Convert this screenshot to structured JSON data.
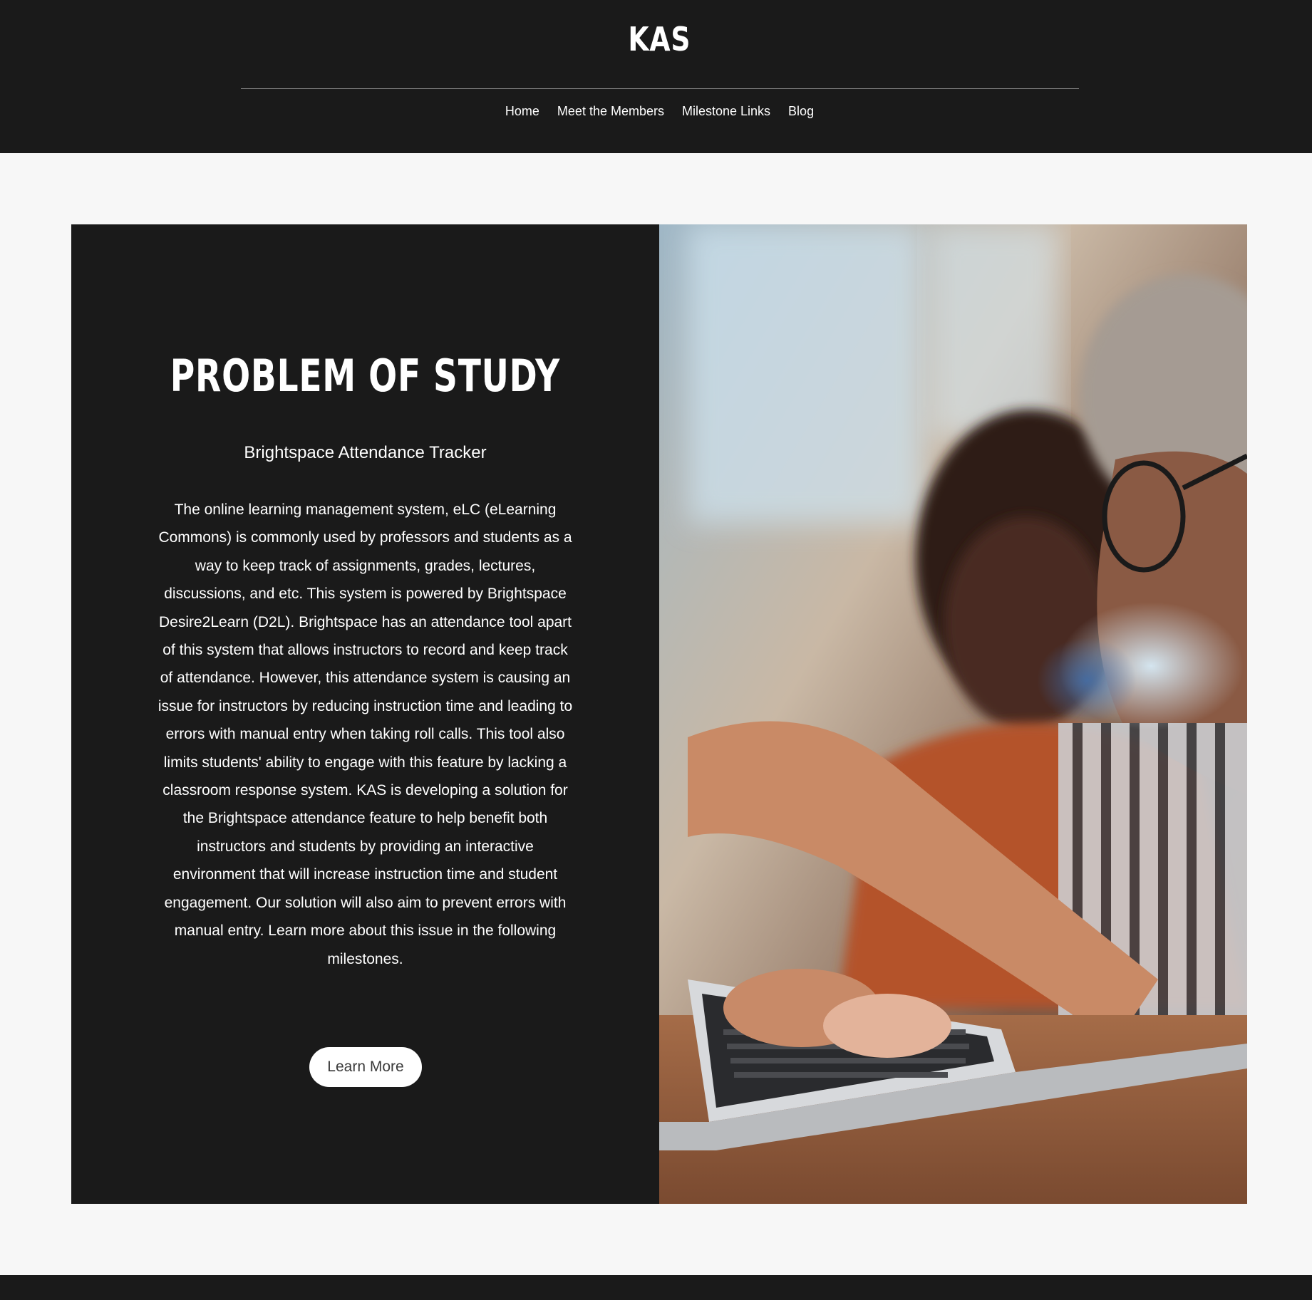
{
  "header": {
    "site_title": "KAS",
    "nav": [
      {
        "label": "Home"
      },
      {
        "label": "Meet the Members"
      },
      {
        "label": "Milestone Links"
      },
      {
        "label": "Blog"
      }
    ]
  },
  "main": {
    "heading": "PROBLEM OF STUDY",
    "subheading": "Brightspace Attendance Tracker",
    "body": "The online learning management system, eLC (eLearning Commons) is commonly used by professors and students as a way to keep track of assignments, grades, lectures, discussions, and etc. This system is powered by Brightspace Desire2Learn (D2L). Brightspace has an attendance tool apart of this system that allows instructors to record and keep track of attendance. However, this attendance system is causing an issue for instructors by reducing instruction time and leading to errors with manual entry when taking roll calls. This tool also limits students' ability to engage with this feature by lacking a classroom response system. KAS is developing a solution for the Brightspace attendance feature to help benefit both instructors and students by providing an interactive environment that will increase instruction time and student engagement. Our solution will also aim to prevent errors with manual entry. Learn more about this issue in the following milestones.",
    "button_label": "Learn More"
  },
  "colors": {
    "header_bg": "#1a1a1a",
    "page_bg": "#f7f7f7",
    "panel_bg": "#1a1a1a",
    "text": "#ffffff",
    "button_bg": "#ffffff"
  }
}
